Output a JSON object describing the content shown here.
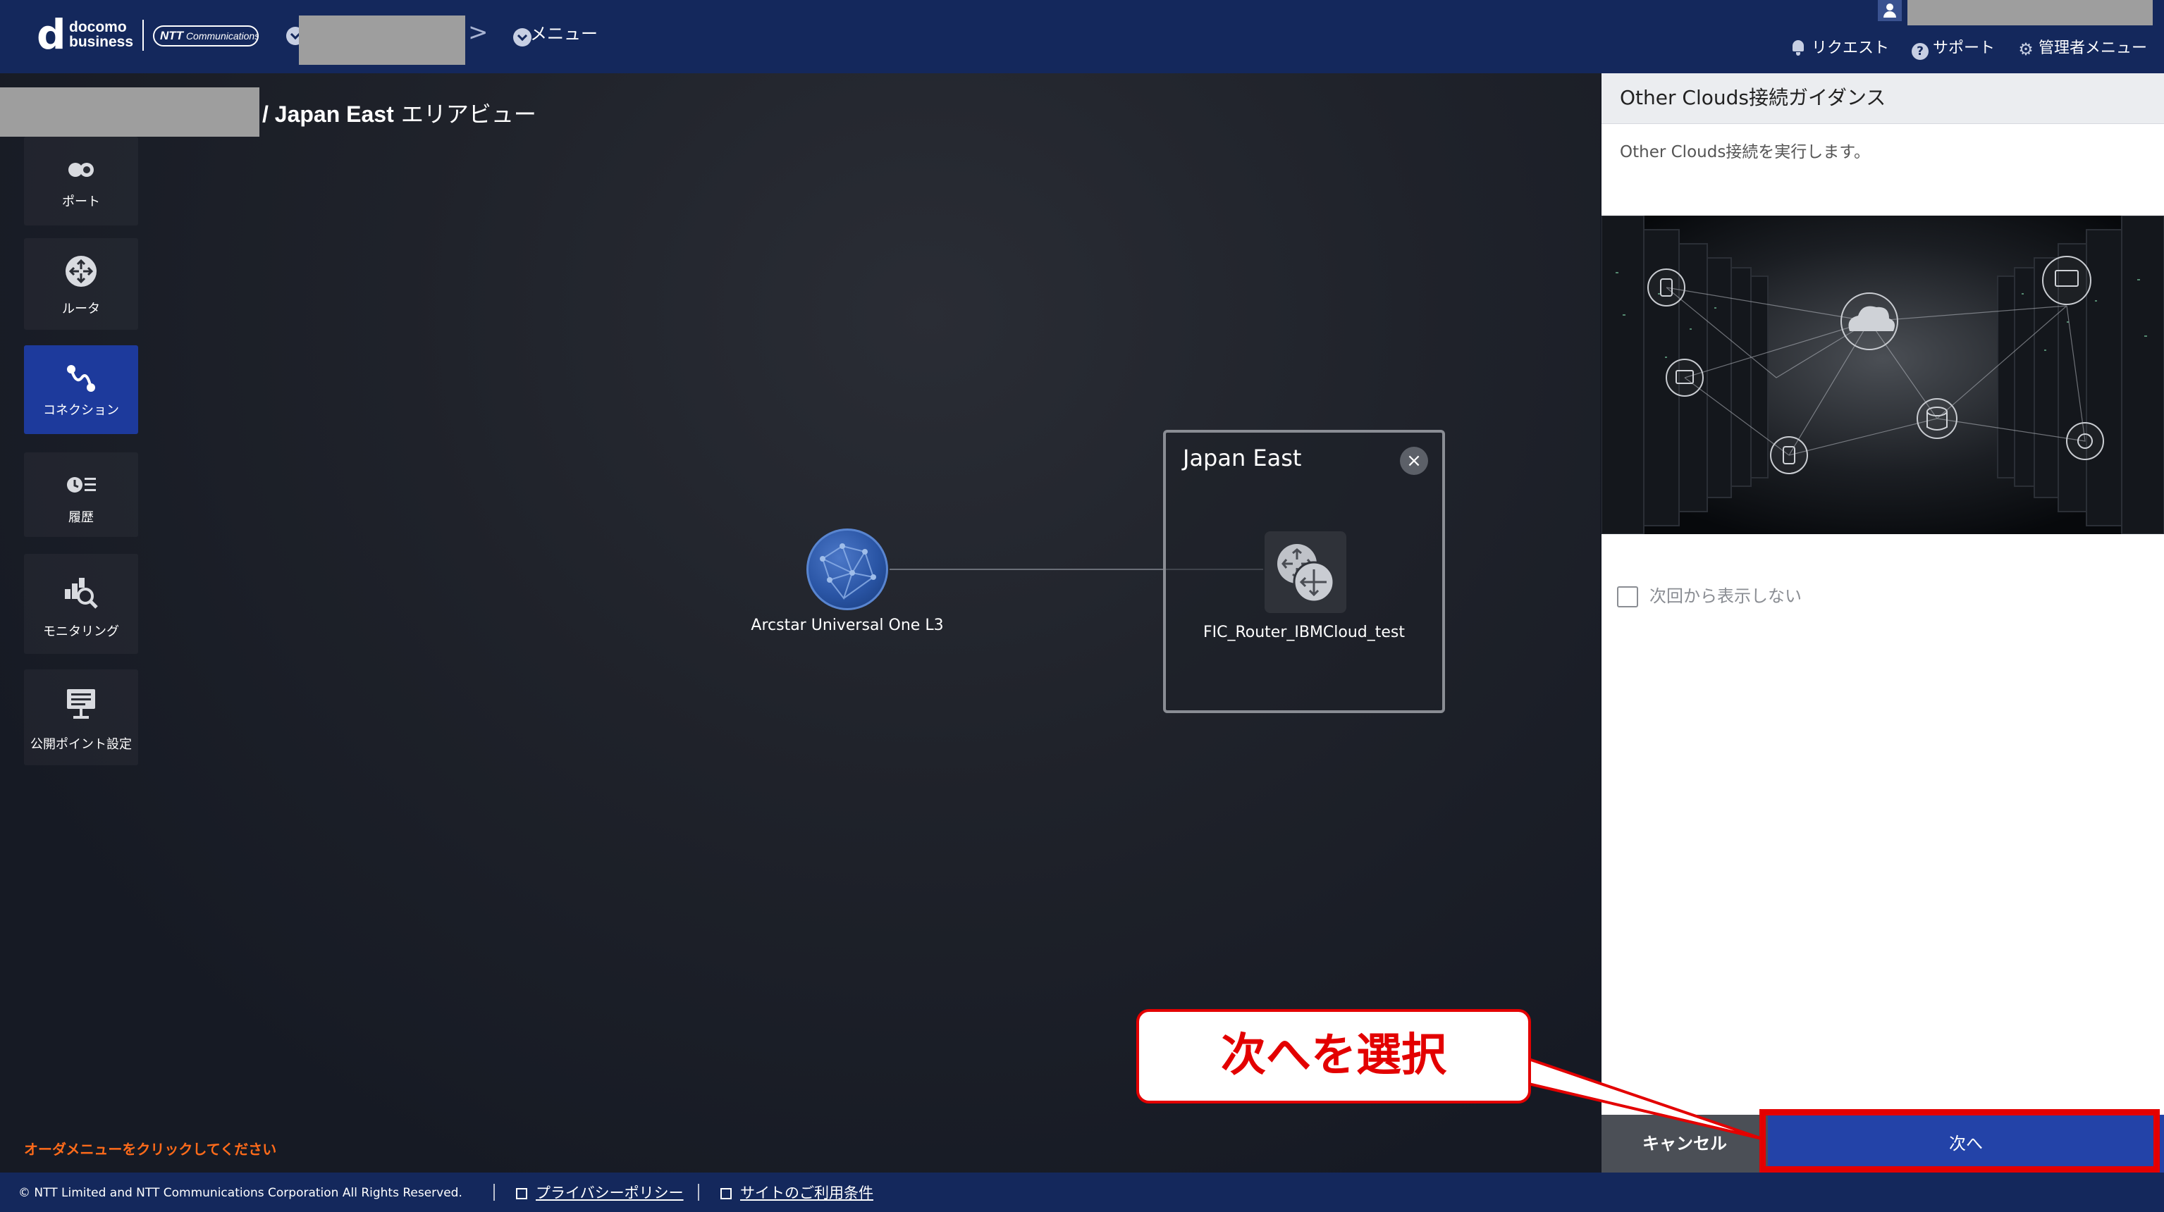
{
  "header": {
    "logo_mark": "d",
    "logo_text_line1": "docomo",
    "logo_text_line2": "business",
    "ntt_logo_bold": "NTT",
    "ntt_logo_text": "Communications",
    "breadcrumb_chevron": ">",
    "menu_label": "メニュー",
    "links": {
      "request": "リクエスト",
      "support": "サポート",
      "support_icon_glyph": "?",
      "admin_menu": "管理者メニュー",
      "admin_icon_glyph": "⚙"
    }
  },
  "page": {
    "area_title_bold": "/ Japan East",
    "area_title_rest": " エリアビュー"
  },
  "sidebar": {
    "items": [
      {
        "label": "ポート",
        "icon": "port-icon",
        "active": false
      },
      {
        "label": "ルータ",
        "icon": "router-icon",
        "active": false
      },
      {
        "label": "コネクション",
        "icon": "connection-icon",
        "active": true
      },
      {
        "label": "履歴",
        "icon": "history-icon",
        "active": false
      },
      {
        "label": "モニタリング",
        "icon": "monitoring-icon",
        "active": false
      },
      {
        "label": "公開ポイント設定",
        "icon": "public-point-icon",
        "active": false
      }
    ]
  },
  "canvas": {
    "external_node_label": "Arcstar Universal One L3",
    "area_box_title": "Japan East",
    "area_close_glyph": "×",
    "router_node_label": "FIC_Router_IBMCloud_test"
  },
  "order_hint": "オーダメニューをクリックしてください",
  "panel": {
    "title": "Other Clouds接続ガイダンス",
    "description": "Other Clouds接続を実行します。",
    "hero_image": "datacenter-cloud-network-image",
    "checkbox_label": "次回から表示しない",
    "checkbox_checked": false,
    "cancel_label": "キャンセル",
    "next_label": "次へ"
  },
  "annotation": {
    "callout_text": "次へを選択",
    "color": "#e30000"
  },
  "footer": {
    "copyright": "© NTT Limited and NTT Communications Corporation All Rights Reserved.",
    "privacy_link": "プライバシーポリシー",
    "terms_link": "サイトのご利用条件"
  },
  "colors": {
    "header_bg": "#14285c",
    "stage_bg": "#1f222a",
    "active_nav": "#1d3a9c",
    "next_button": "#2343a8",
    "cancel_button": "#4b4f56",
    "hint_orange": "#ff6b1a",
    "annotation_red": "#e30000"
  }
}
